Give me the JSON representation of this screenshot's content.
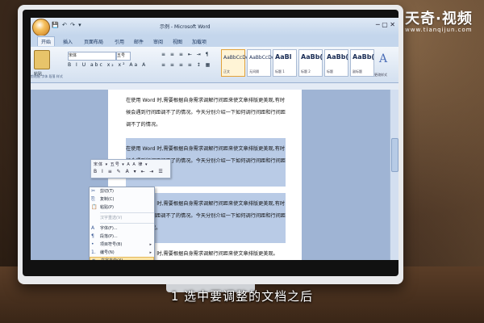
{
  "subtitle": "1 选中要调整的文档之后",
  "logo": {
    "name": "天奇·视频",
    "url": "www.tianqijun.com",
    "accent": "#ff7a1a"
  },
  "word": {
    "title": "示例 - Microsoft Word",
    "quick_access": "💾 ↶ ↷ ▾",
    "window_controls": "─ ▢ ✕",
    "tabs": [
      "开始",
      "插入",
      "页面布局",
      "引用",
      "邮件",
      "审阅",
      "视图",
      "加载项"
    ],
    "paste_label": "粘贴",
    "font_name": "宋体",
    "font_size": "五号",
    "format_row": "B I U abc x₂ x² Aa A",
    "paragraph_row1": "≡ ≡ ≡ ⇤ ⇥ ¶",
    "paragraph_row2": "≡ ≡ ≡ ≡ ↕ ▦",
    "styles": [
      {
        "sample": "AaBbCcDd",
        "name": "正文",
        "big": false
      },
      {
        "sample": "AaBbCcDd",
        "name": "无间隔",
        "big": false
      },
      {
        "sample": "AaBl",
        "name": "标题 1",
        "big": true
      },
      {
        "sample": "AaBb(",
        "name": "标题 2",
        "big": true
      },
      {
        "sample": "AaBb(",
        "name": "标题",
        "big": true
      },
      {
        "sample": "AaBb(",
        "name": "副标题",
        "big": true
      }
    ],
    "change_styles_label": "更改样式",
    "group_labels": "剪贴板        字体                         段落                    样式"
  },
  "document": {
    "para1": "在使用 Word 时,需要根据自身需求调解行间距来使文章排版更美观,有时候会遇到行间距调不了的情况。今天分别介绍一下如何调行间距和行间距调不了的情况。",
    "para2": "在使用 Word 时,需要根据自身需求调解行间距来使文章排版更美观,有时候会遇到行间距调不了的情况。今天分别介绍一下如何调行间距和行间距调不了的情况。",
    "para3": "在使用 Word 时,需要根据自身需求调解行间距来使文章排版更美观,有时候会遇到行间距调不了的情况。今天分别介绍一下如何调行间距和行间距调不了的情况。",
    "para4": "在使用 Word 时,需要根据自身需求调解行间距来使文章排版更美观。"
  },
  "minibar": {
    "row1": "宋体 ▾ 五号 ▾ A A 律 ▾",
    "row2": "B I ≡ ✎ A ▾ ⇤ ⇥ ☰"
  },
  "context_menu": [
    {
      "label": "剪切(T)",
      "icon": "✂",
      "disabled": false,
      "arrow": false,
      "hot": false
    },
    {
      "label": "复制(C)",
      "icon": "⎘",
      "disabled": false,
      "arrow": false,
      "hot": false
    },
    {
      "label": "粘贴(P)",
      "icon": "📋",
      "disabled": false,
      "arrow": false,
      "hot": false
    },
    {
      "sep": true
    },
    {
      "label": "汉字重选(V)",
      "icon": "",
      "disabled": true,
      "arrow": false,
      "hot": false
    },
    {
      "sep": true
    },
    {
      "label": "字体(F)...",
      "icon": "A",
      "disabled": false,
      "arrow": false,
      "hot": false
    },
    {
      "label": "段落(P)...",
      "icon": "¶",
      "disabled": false,
      "arrow": false,
      "hot": false
    },
    {
      "label": "项目符号(B)",
      "icon": "•",
      "disabled": false,
      "arrow": true,
      "hot": false
    },
    {
      "label": "编号(N)",
      "icon": "1.",
      "disabled": false,
      "arrow": true,
      "hot": false
    },
    {
      "label": "文字方向(X)...",
      "icon": "⇅",
      "disabled": false,
      "arrow": false,
      "hot": true
    },
    {
      "label": "插入符号(S)",
      "icon": "Ω",
      "disabled": false,
      "arrow": false,
      "hot": false
    }
  ]
}
